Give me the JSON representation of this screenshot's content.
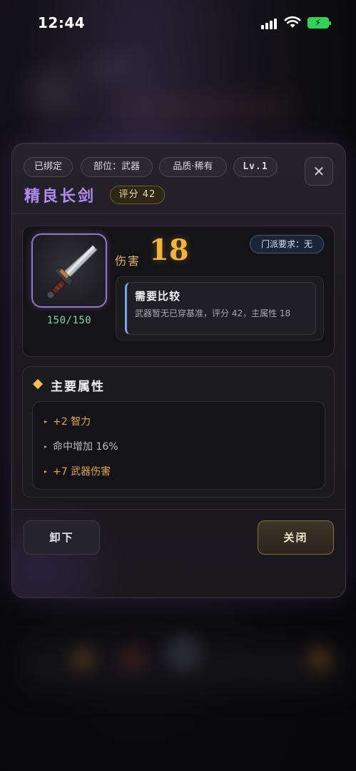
{
  "status_bar": {
    "time": "12:44"
  },
  "item": {
    "tags": {
      "bound": "已绑定",
      "slot": "部位：武器",
      "quality": "品质·稀有",
      "level": "Lv.1"
    },
    "name": "精良长剑",
    "score": "评分 42",
    "durability": "150/150",
    "icon": "sword-icon",
    "damage_label": "伤害",
    "damage_value": "18",
    "sect_requirement": "门派要求：无",
    "compare": {
      "title": "需要比较",
      "description": "武器暂无已穿基准，评分 42，主属性 18"
    }
  },
  "attributes": {
    "title": "主要属性",
    "rows": [
      {
        "text": "+2 智力",
        "color": "#e3a64a"
      },
      {
        "text": "命中增加 16%",
        "color": "#bdb9c4"
      },
      {
        "text": "+7 武器伤害",
        "color": "#e3a64a"
      }
    ]
  },
  "actions": {
    "unequip": "卸下",
    "close": "关闭"
  },
  "colors": {
    "title_purple": "#b28bf2",
    "damage_gold": "#f1b43c",
    "durability_green": "#7fd8a0"
  }
}
